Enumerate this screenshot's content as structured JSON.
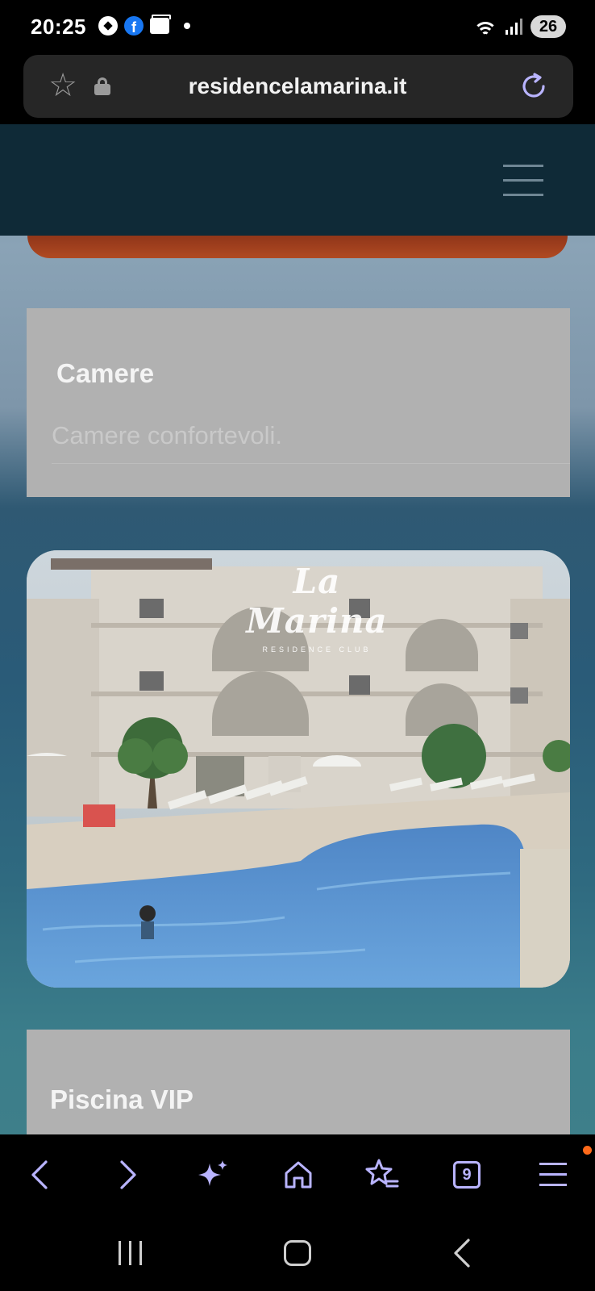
{
  "status_bar": {
    "time": "20:25",
    "notification_icons": [
      "soccer-ball-icon",
      "facebook-icon",
      "wallet-icon",
      "dot-icon"
    ],
    "system_icons": [
      "wifi-icon",
      "signal-icon",
      "battery-icon"
    ],
    "battery_level": "26"
  },
  "browser": {
    "url": "residencelamarina.it",
    "bookmark_icon": "star-icon",
    "secure_icon": "lock-icon",
    "reload_icon": "reload-icon",
    "accent_color": "#b9b4ff"
  },
  "site": {
    "header_color": "#0f2a37",
    "menu_icon": "hamburger-menu-icon",
    "cards": [
      {
        "title": "Camere",
        "description": "Camere confortevoli."
      },
      {
        "title": "Piscina VIP"
      }
    ],
    "photo": {
      "logo_text": "La Marina",
      "logo_subtext": "RESIDENCE CLUB"
    }
  },
  "toolbar": {
    "back_icon": "chevron-left-icon",
    "forward_icon": "chevron-right-icon",
    "ai_icon": "sparkle-icon",
    "home_icon": "home-icon",
    "bookmarks_icon": "star-list-icon",
    "tabs_count": "9",
    "menu_icon": "menu-icon"
  },
  "system_nav": {
    "recents_icon": "recents-icon",
    "home_icon": "home-circle-icon",
    "back_icon": "back-icon"
  }
}
